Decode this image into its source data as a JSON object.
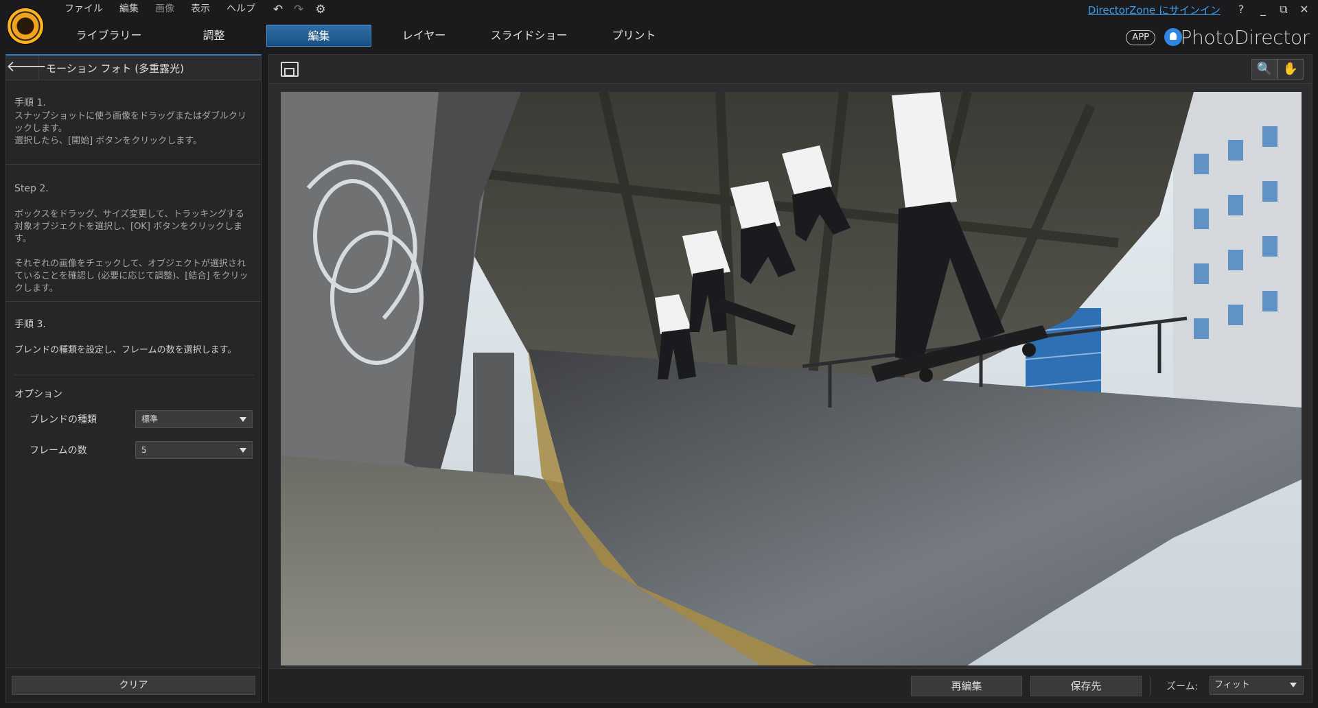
{
  "menu": [
    {
      "label": "ファイル",
      "dim": false
    },
    {
      "label": "編集",
      "dim": false
    },
    {
      "label": "画像",
      "dim": true
    },
    {
      "label": "表示",
      "dim": false
    },
    {
      "label": "ヘルプ",
      "dim": false
    }
  ],
  "toolbar": {
    "undo_icon": "↶",
    "redo_icon": "↷",
    "settings_icon": "⚙"
  },
  "tabs": [
    {
      "label": "ライブラリー",
      "active": false
    },
    {
      "label": "調整",
      "active": false
    },
    {
      "label": "編集",
      "active": true
    },
    {
      "label": "レイヤー",
      "active": false
    },
    {
      "label": "スライドショー",
      "active": false
    },
    {
      "label": "プリント",
      "active": false
    }
  ],
  "header": {
    "signin": "DirectorZone にサインイン",
    "help": "?",
    "minimize": "_",
    "restore": "⧉",
    "close": "✕",
    "app_badge": "APP",
    "brand": "PhotoDirector"
  },
  "panel": {
    "back_icon": "🡐",
    "title": "モーション フォト (多重露光)",
    "step1": {
      "title": "手順 1.",
      "text": "スナップショットに使う画像をドラッグまたはダブルクリックします。",
      "text2": "選択したら、[開始] ボタンをクリックします。"
    },
    "step2": {
      "title": "Step 2.",
      "text": "ボックスをドラッグ、サイズ変更して、トラッキングする対象オブジェクトを選択し、[OK] ボタンをクリックします。",
      "text2": "それぞれの画像をチェックして、オブジェクトが選択されていることを確認し (必要に応じて調整)、[結合] をクリックします。"
    },
    "step3": {
      "title": "手順 3.",
      "text": "ブレンドの種類を設定し、フレームの数を選択します。"
    },
    "options_title": "オプション",
    "blend_label": "ブレンドの種類",
    "blend_value": "標準",
    "frames_label": "フレームの数",
    "frames_value": "5",
    "clear_button": "クリア"
  },
  "preview": {
    "zoom_tool_icon": "🔍",
    "pan_tool_icon": "✋",
    "reedit_button": "再編集",
    "save_button": "保存先",
    "zoom_label": "ズーム:",
    "zoom_value": "フィット"
  }
}
